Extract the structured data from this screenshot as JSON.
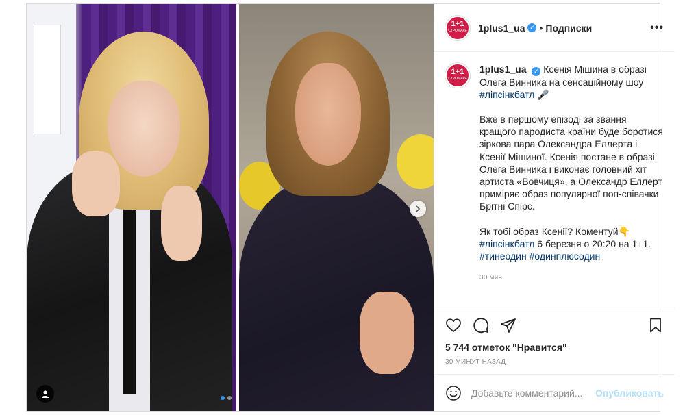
{
  "header": {
    "username": "1plus1_ua",
    "separator": "•",
    "follow_label": "Подписки",
    "more_label": "•••",
    "avatar_text": "1+1",
    "avatar_sub": "СТРОМАКЕ"
  },
  "caption": {
    "username": "1plus1_ua",
    "line1": "Ксенія Мішина в образі Олега Винника на сенсаційному шоу",
    "hashtag1": "#ліпсінкбатл",
    "emoji1": "🎤",
    "para2": "Вже в першому епізоді за звання кращого пародиста країни буде боротися зіркова пара Олександра Еллерта і Ксенії Мішиної. Ксенія постане в образі Олега Винника і виконає головний хіт артиста «Вовчиця», а Олександр Еллерт приміряє образ популярної поп-співачки Брітні Спірс.",
    "para3_start": "Як тобі образ Ксенії? Коментуй",
    "emoji2": "👇",
    "hashtag2": "#ліпсінкбатл",
    "para3_end": " 6 березня о 20:20 на 1+1.",
    "hashtag3": "#тинеодин",
    "hashtag4": "#одинплюсодин",
    "time_ago": "30 мин."
  },
  "actions": {
    "like_icon": "heart-icon",
    "comment_icon": "comment-icon",
    "share_icon": "share-icon",
    "save_icon": "bookmark-icon",
    "likes_text": "5 744 отметок \"Нравится\"",
    "post_date": "30 МИНУТ НАЗАД"
  },
  "comment": {
    "placeholder": "Добавьте комментарий...",
    "publish_label": "Опубликовать"
  },
  "carousel": {
    "total": 2,
    "active": 0
  },
  "colors": {
    "accent": "#3897f0",
    "brand": "#d11e48",
    "link": "#00376b",
    "publish_disabled": "#b2dffc"
  }
}
